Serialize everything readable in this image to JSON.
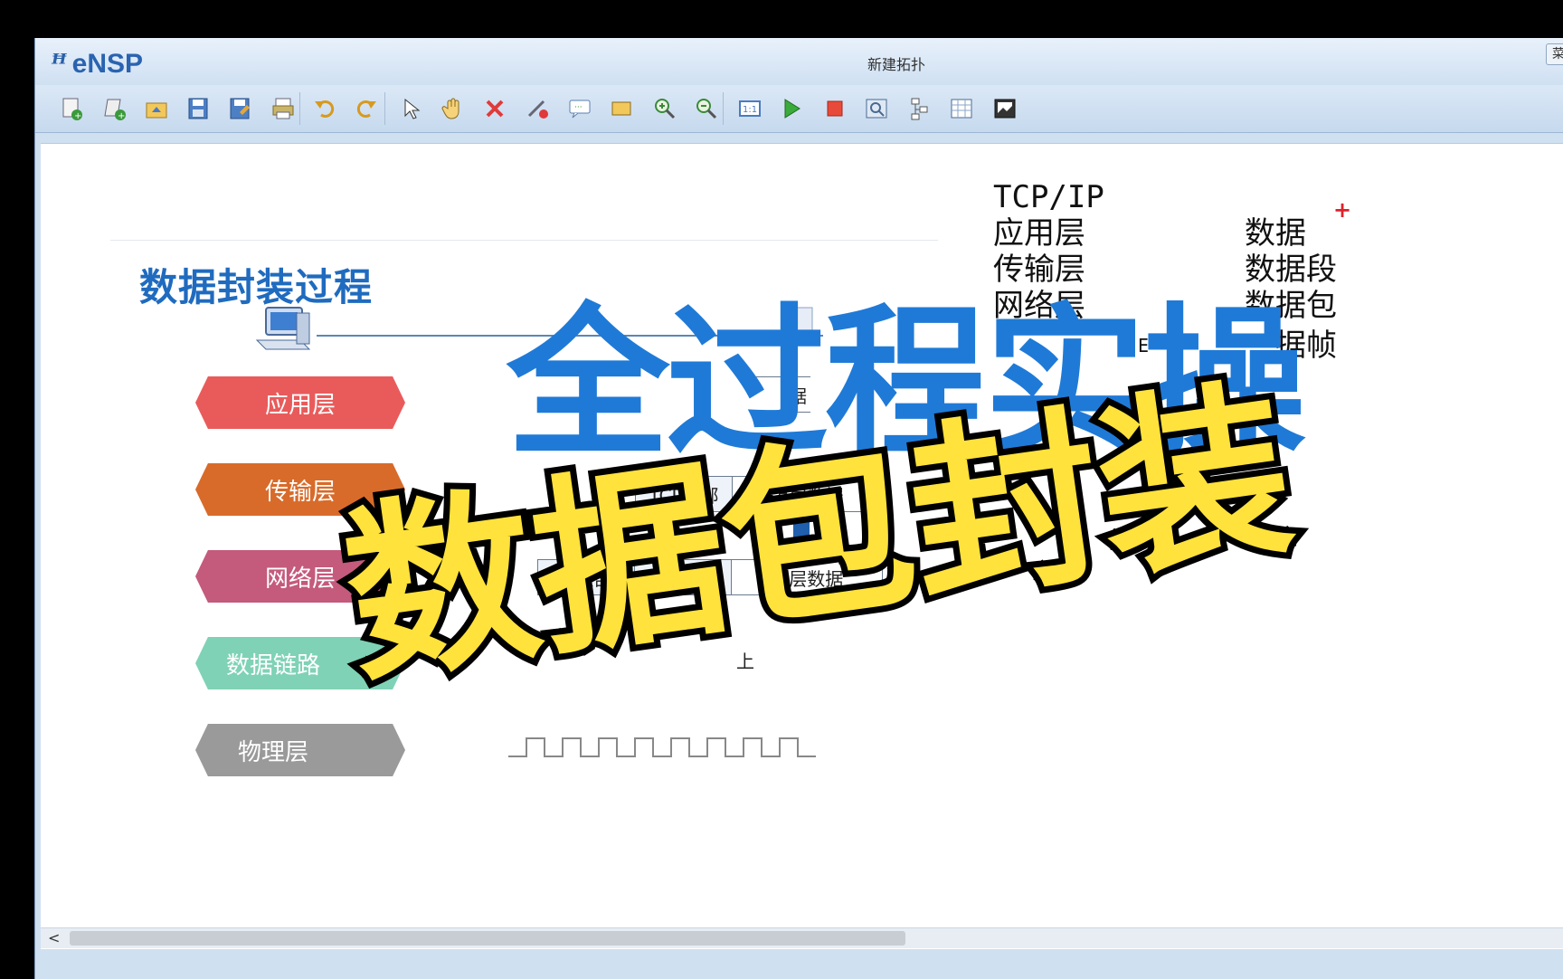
{
  "app": {
    "logo": "eNSP",
    "logo_mark": "ꟸ",
    "window_title": "新建拓扑",
    "corner_text": "菜"
  },
  "toolbar": {
    "icons": [
      "new-topology-icon",
      "new-lab-icon",
      "open-icon",
      "save-icon",
      "save-as-icon",
      "print-icon",
      "undo-icon",
      "redo-icon",
      "select-icon",
      "pan-hand-icon",
      "delete-icon",
      "delete-link-icon",
      "text-note-icon",
      "rectangle-icon",
      "zoom-in-icon",
      "zoom-out-icon",
      "fit-icon",
      "start-device-icon",
      "stop-device-icon",
      "capture-icon",
      "topology-icon",
      "grid-icon",
      "screenshot-icon"
    ]
  },
  "slide": {
    "title": "数据封装过程",
    "layers": [
      {
        "label": "应用层",
        "color": "#e95b5b"
      },
      {
        "label": "传输层",
        "color": "#d86b2a"
      },
      {
        "label": "网络层",
        "color": "#c45a7c"
      },
      {
        "label": "数据链路",
        "color": "#7fd2b5"
      },
      {
        "label": "物理层",
        "color": "#9a9a9a"
      }
    ],
    "packet_top_tail": "据",
    "packet_tcp": {
      "header": "TCP头部",
      "data": "上层数据"
    },
    "packet_ip": {
      "ip": "IP头部",
      "tcp": "TCP头部",
      "data": "上层数据"
    },
    "packet_bottom_text": "上"
  },
  "side_text": {
    "heading": "TCP/IP",
    "rows": [
      {
        "layer": "应用层",
        "unit": "数据"
      },
      {
        "layer": "传输层",
        "unit": "数据段"
      },
      {
        "layer": "网络层",
        "unit": "数据包"
      },
      {
        "layer": "E",
        "unit": "据帧"
      }
    ],
    "plus": "+"
  },
  "overlay": {
    "line1": "全过程实操",
    "line2": "数据包封装"
  },
  "colors": {
    "accent_blue": "#1f7ad7",
    "overlay_yellow": "#ffe23c"
  }
}
